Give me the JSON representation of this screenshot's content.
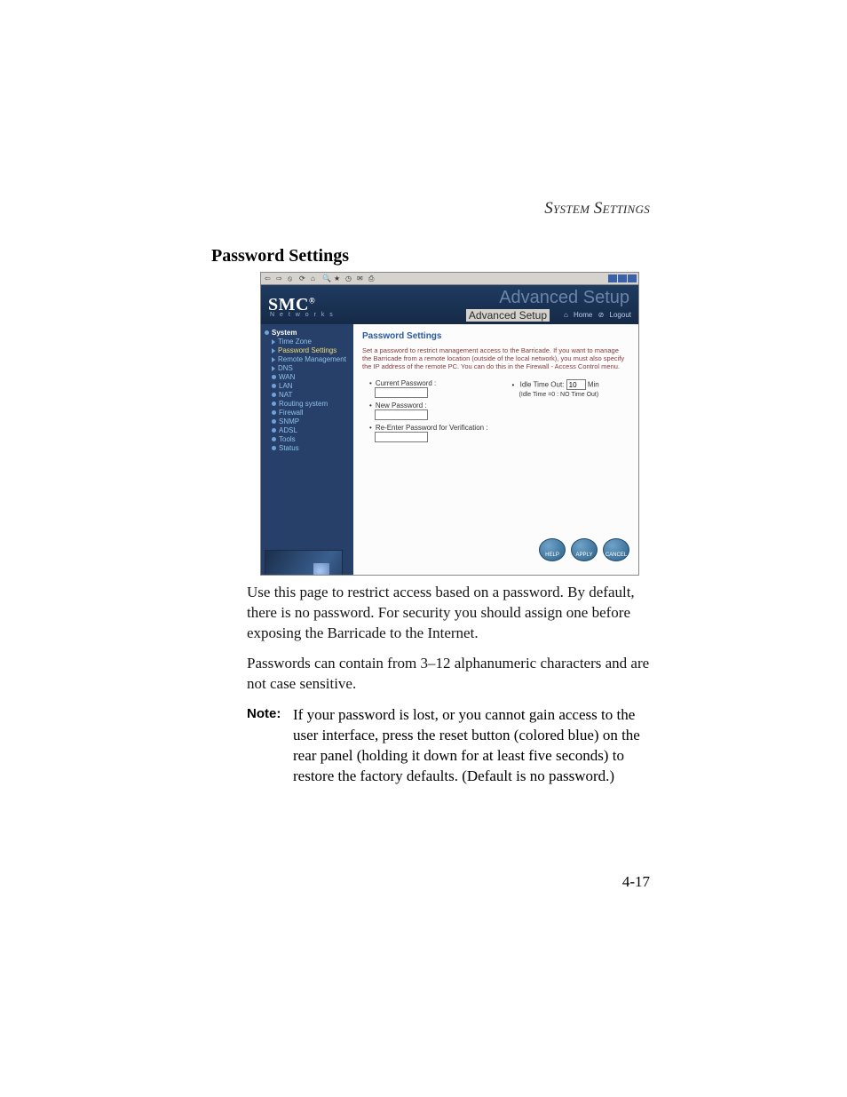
{
  "running_head": "SYSTEM SETTINGS",
  "section_title": "Password Settings",
  "screenshot": {
    "logo": "SMC",
    "logo_reg": "®",
    "logo_sub": "N e t w o r k s",
    "hdr_big": "Advanced Setup",
    "hdr_small": "Advanced Setup",
    "home_link": "Home",
    "logout_link": "Logout",
    "sidebar": {
      "head": "System",
      "items": [
        {
          "label": "Time Zone",
          "type": "arrow"
        },
        {
          "label": "Password Settings",
          "type": "arrow",
          "active": true
        },
        {
          "label": "Remote Management",
          "type": "arrow"
        },
        {
          "label": "DNS",
          "type": "arrow"
        },
        {
          "label": "WAN",
          "type": "bullet"
        },
        {
          "label": "LAN",
          "type": "bullet"
        },
        {
          "label": "NAT",
          "type": "bullet"
        },
        {
          "label": "Routing system",
          "type": "bullet"
        },
        {
          "label": "Firewall",
          "type": "bullet"
        },
        {
          "label": "SNMP",
          "type": "bullet"
        },
        {
          "label": "ADSL",
          "type": "bullet"
        },
        {
          "label": "Tools",
          "type": "bullet"
        },
        {
          "label": "Status",
          "type": "bullet"
        }
      ]
    },
    "content": {
      "title": "Password Settings",
      "desc": "Set a password to restrict management access to the Barricade. If you want to manage the Barricade from a remote location (outside of the local network), you must also specify the IP address of the remote PC. You can do this in the Firewall - Access Control menu.",
      "current_pw_label": "Current Password :",
      "new_pw_label": "New Password :",
      "confirm_pw_label": "Re-Enter Password for Verification :",
      "idle_label_pre": "Idle Time Out:",
      "idle_value": "10",
      "idle_label_post": "Min",
      "idle_note": "(Idle Time =0 : NO Time Out)",
      "btn_help": "HELP",
      "btn_apply": "APPLY",
      "btn_cancel": "CANCEL"
    }
  },
  "para1": "Use this page to restrict access based on a password. By default, there is no password. For security you should assign one before exposing the Barricade to the Internet.",
  "para2": "Passwords can contain from 3–12 alphanumeric characters and are not case sensitive.",
  "note_label": "Note:",
  "note_body": "If your password is lost, or you cannot gain access to the user interface, press the reset button (colored blue) on the rear panel (holding it down for at least five seconds) to restore the factory defaults. (Default is no password.)",
  "page_number": "4-17"
}
